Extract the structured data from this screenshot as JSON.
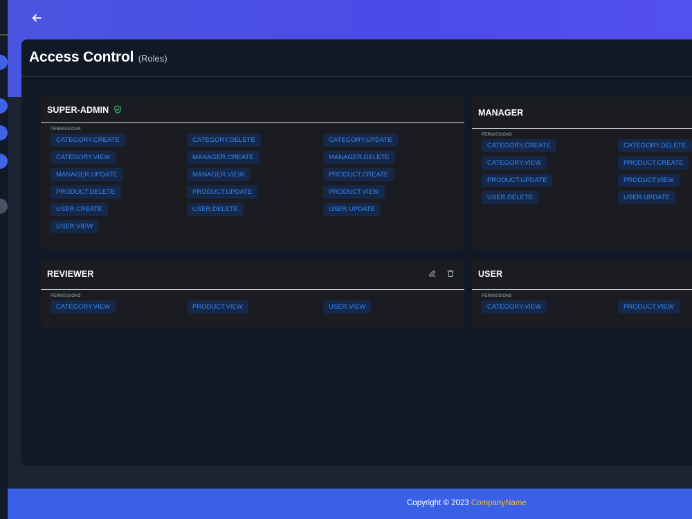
{
  "page": {
    "title": "Access Control",
    "subtitle": "(Roles)"
  },
  "permissions_label": "PERMISSIONS",
  "roles": [
    {
      "name": "SUPER-ADMIN",
      "permissions": [
        "CATEGORY.CREATE",
        "CATEGORY.DELETE",
        "CATEGORY.UPDATE",
        "CATEGORY.VIEW",
        "MANAGER.CREATE",
        "MANAGER.DELETE",
        "MANAGER.UPDATE",
        "MANAGER.VIEW",
        "PRODUCT.CREATE",
        "PRODUCT.DELETE",
        "PRODUCT.UPDATE",
        "PRODUCT.VIEW",
        "USER.CREATE",
        "USER.DELETE",
        "USER.UPDATE",
        "USER.VIEW"
      ]
    },
    {
      "name": "MANAGER",
      "permissions": [
        "CATEGORY.CREATE",
        "CATEGORY.DELETE",
        "CATEGORY.VIEW",
        "PRODUCT.CREATE",
        "PRODUCT.UPDATE",
        "PRODUCT.VIEW",
        "USER.DELETE",
        "USER.UPDATE"
      ]
    },
    {
      "name": "REVIEWER",
      "permissions": [
        "CATEGORY.VIEW",
        "PRODUCT.VIEW",
        "USER.VIEW"
      ]
    },
    {
      "name": "USER",
      "permissions": [
        "CATEGORY.VIEW",
        "PRODUCT.VIEW"
      ]
    }
  ],
  "icons": {
    "back": "arrow-left-icon",
    "verified": "shield-check-icon",
    "edit": "pencil-icon",
    "delete": "trash-icon"
  },
  "footer": {
    "copyright": "Copyright © 2023",
    "company": "CompanyName"
  },
  "colors": {
    "accent": "#4a55e0",
    "chip_bg": "#15284a",
    "chip_text": "#3a86ee",
    "verified_green": "#3ec46d",
    "company_link": "#f5b73b"
  }
}
